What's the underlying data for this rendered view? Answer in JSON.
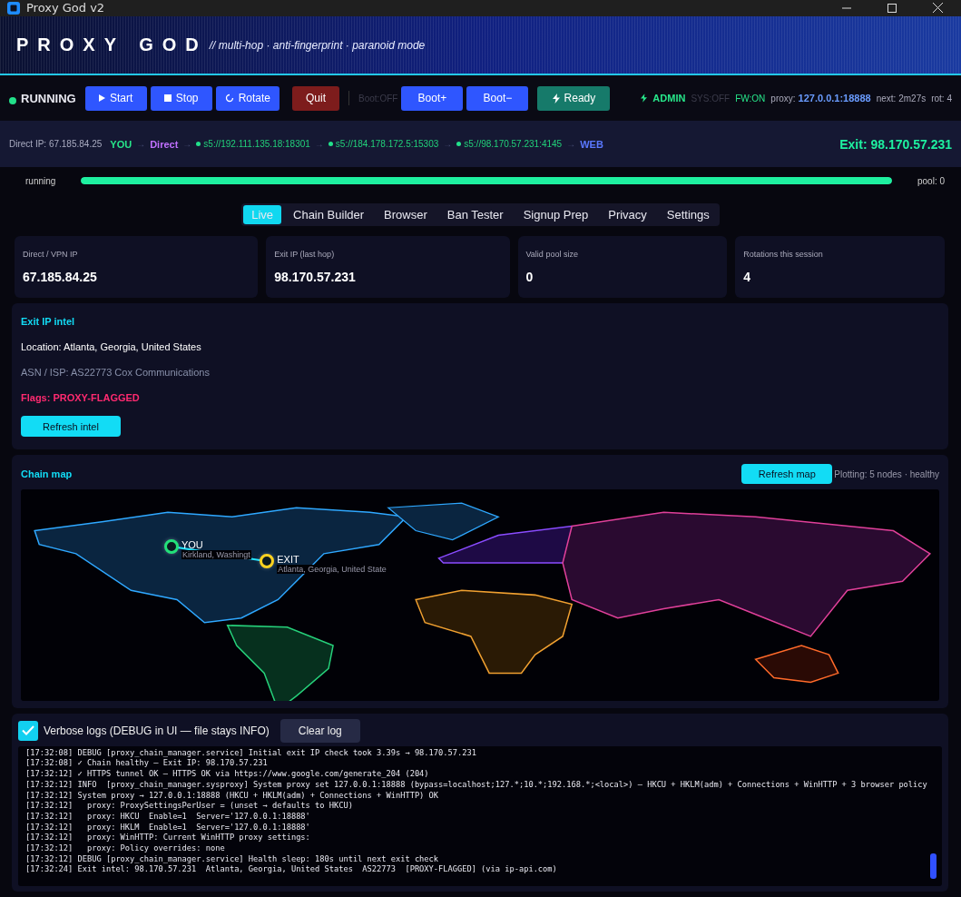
{
  "window": {
    "title": "Proxy God  v2"
  },
  "banner": {
    "title": "PROXY GOD",
    "subtitle": "// multi-hop · anti-fingerprint · paranoid mode"
  },
  "toolbar": {
    "status": {
      "label": "RUNNING",
      "on": true
    },
    "buttons": [
      {
        "label": "Start",
        "kind": "start"
      },
      {
        "label": "Stop",
        "kind": "stop"
      },
      {
        "label": "Rotate",
        "kind": "rotate"
      },
      {
        "label": "Quit",
        "kind": "quit"
      }
    ],
    "boot_status": {
      "label": "Boot:OFF",
      "disabled": true
    },
    "boot_buttons": [
      {
        "label": "Boot+",
        "kind": "primary"
      },
      {
        "label": "Boot−",
        "kind": "primary"
      }
    ],
    "ready_button": {
      "label": "Ready",
      "kind": "ready"
    },
    "indicators": [
      {
        "label": "ADMIN",
        "kind": "admin"
      },
      {
        "label": "SYS:OFF",
        "kind": "muted"
      },
      {
        "label": "FW:ON",
        "kind": "ok"
      },
      {
        "label": "proxy:",
        "kind": "plain"
      },
      {
        "label": "127.0.0.1:18888",
        "kind": "accent"
      },
      {
        "label": "next: 2m27s",
        "kind": "plain"
      },
      {
        "label": "rot: 4",
        "kind": "plain"
      }
    ]
  },
  "chain": {
    "direct_ip": "Direct IP: 67.185.84.25",
    "separator": "→",
    "hops": [
      {
        "label": "YOU",
        "kind": "you"
      },
      {
        "label": "Direct",
        "kind": "direct"
      },
      {
        "label": "s5://192.111.135.18:18301",
        "kind": "proxy"
      },
      {
        "label": "s5://184.178.172.5:15303",
        "kind": "proxy"
      },
      {
        "label": "s5://98.170.57.231:4145",
        "kind": "proxy"
      },
      {
        "label": "WEB",
        "kind": "web"
      }
    ],
    "exit": "Exit: 98.170.57.231"
  },
  "progress": {
    "label": "running",
    "level": 1.0,
    "pool": "pool: 0"
  },
  "tabs": [
    {
      "label": "Live",
      "selected": true
    },
    {
      "label": "Chain Builder",
      "selected": false
    },
    {
      "label": "Browser",
      "selected": false
    },
    {
      "label": "Ban Tester",
      "selected": false
    },
    {
      "label": "Signup Prep",
      "selected": false
    },
    {
      "label": "Privacy",
      "selected": false
    },
    {
      "label": "Settings",
      "selected": false
    }
  ],
  "stats": [
    {
      "label": "Direct / VPN IP",
      "value": "67.185.84.25"
    },
    {
      "label": "Exit IP  (last hop)",
      "value": "98.170.57.231"
    },
    {
      "label": "Valid pool size",
      "value": "0"
    },
    {
      "label": "Rotations this session",
      "value": "4"
    }
  ],
  "intel": {
    "title": "Exit IP intel",
    "lines": [
      {
        "text": "Location: Atlanta, Georgia, United States",
        "kind": "normal"
      },
      {
        "text": "ASN / ISP: AS22773 Cox Communications",
        "kind": "muted"
      },
      {
        "text": "Flags: PROXY-FLAGGED",
        "kind": "alert"
      }
    ],
    "button": "Refresh intel"
  },
  "map": {
    "title": "Chain map",
    "button": "Refresh map",
    "status": "Plotting: 5 nodes · healthy",
    "nodes": [
      {
        "label": "YOU",
        "place": "Kirkland, Washingt",
        "kind": "origin"
      },
      {
        "label": "EXIT",
        "place": "Atlanta, Georgia, United State",
        "kind": "exit"
      }
    ]
  },
  "log": {
    "verbose": {
      "label": "Verbose logs (DEBUG in UI — file stays INFO)",
      "checked": true
    },
    "clear_button": "Clear log",
    "lines": [
      "[17:32:08] DEBUG [proxy_chain_manager.service] Initial exit IP check took 3.39s → 98.170.57.231",
      "[17:32:08] ✓ Chain healthy — Exit IP: 98.170.57.231",
      "[17:32:12] ✓ HTTPS tunnel OK — HTTPS OK via https://www.google.com/generate_204 (204)",
      "[17:32:12] INFO  [proxy_chain_manager.sysproxy] System proxy set 127.0.0.1:18888 (bypass=localhost;127.*;10.*;192.168.*;<local>) — HKCU + HKLM(adm) + Connections + WinHTTP + 3 browser policy",
      "[17:32:12] System proxy → 127.0.0.1:18888 (HKCU + HKLM(adm) + Connections + WinHTTP) OK",
      "[17:32:12]   proxy: ProxySettingsPerUser = (unset → defaults to HKCU)",
      "[17:32:12]   proxy: HKCU  Enable=1  Server='127.0.0.1:18888'",
      "[17:32:12]   proxy: HKLM  Enable=1  Server='127.0.0.1:18888'",
      "[17:32:12]   proxy: WinHTTP: Current WinHTTP proxy settings:",
      "[17:32:12]   proxy: Policy overrides: none",
      "[17:32:12] DEBUG [proxy_chain_manager.service] Health sleep: 180s until next exit check",
      "[17:32:24] Exit intel: 98.170.57.231  Atlanta, Georgia, United States  AS22773  [PROXY-FLAGGED] (via ip-api.com)"
    ]
  }
}
